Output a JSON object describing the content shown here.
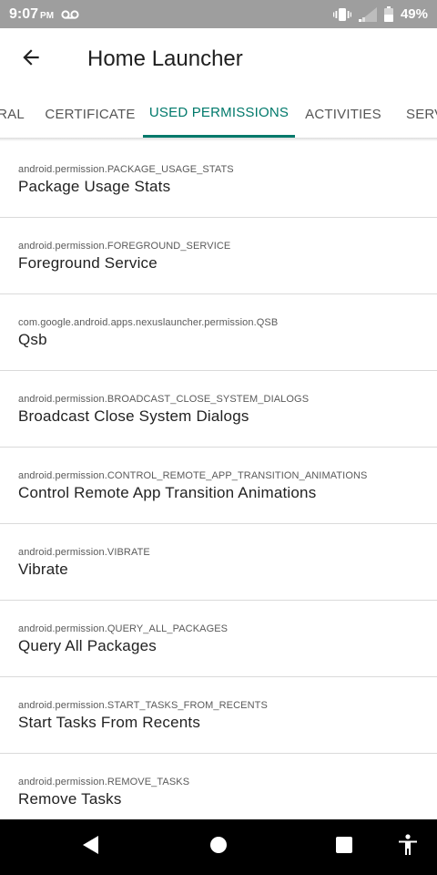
{
  "status_bar": {
    "time": "9:07",
    "ampm": "PM",
    "battery": "49%",
    "icons": [
      "voicemail-icon",
      "vibrate-icon",
      "signal-icon",
      "battery-icon"
    ]
  },
  "app_bar": {
    "title": "Home Launcher",
    "back_icon": "arrow-back-icon"
  },
  "tabs": [
    {
      "label": "RAL",
      "active": false
    },
    {
      "label": "CERTIFICATE",
      "active": false
    },
    {
      "label": "USED PERMISSIONS",
      "active": true
    },
    {
      "label": "ACTIVITIES",
      "active": false
    },
    {
      "label": "SERV",
      "active": false
    }
  ],
  "permissions": [
    {
      "id": "android.permission.PACKAGE_USAGE_STATS",
      "label": "Package Usage Stats"
    },
    {
      "id": "android.permission.FOREGROUND_SERVICE",
      "label": "Foreground Service"
    },
    {
      "id": "com.google.android.apps.nexuslauncher.permission.QSB",
      "label": "Qsb"
    },
    {
      "id": "android.permission.BROADCAST_CLOSE_SYSTEM_DIALOGS",
      "label": "Broadcast Close System Dialogs"
    },
    {
      "id": "android.permission.CONTROL_REMOTE_APP_TRANSITION_ANIMATIONS",
      "label": "Control Remote App Transition Animations"
    },
    {
      "id": "android.permission.VIBRATE",
      "label": "Vibrate"
    },
    {
      "id": "android.permission.QUERY_ALL_PACKAGES",
      "label": "Query All Packages"
    },
    {
      "id": "android.permission.START_TASKS_FROM_RECENTS",
      "label": "Start Tasks From Recents"
    },
    {
      "id": "android.permission.REMOVE_TASKS",
      "label": "Remove Tasks"
    }
  ],
  "nav_bar": {
    "buttons": [
      "back-triangle-icon",
      "home-circle-icon",
      "recents-square-icon",
      "accessibility-icon"
    ]
  },
  "colors": {
    "accent": "#00796b",
    "status_bar": "#9e9e9e",
    "nav_bar": "#000000"
  }
}
